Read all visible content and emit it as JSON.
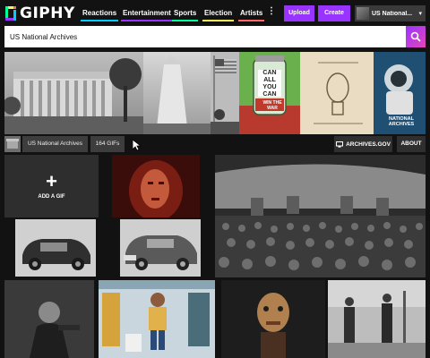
{
  "brand": {
    "name": "GIPHY"
  },
  "nav": {
    "links": [
      {
        "label": "Reactions",
        "accent": "#00ccff"
      },
      {
        "label": "Entertainment",
        "accent": "#9933ff"
      },
      {
        "label": "Sports",
        "accent": "#00ff99"
      },
      {
        "label": "Election",
        "accent": "#fff35c"
      },
      {
        "label": "Artists",
        "accent": "#ff6666"
      }
    ],
    "more_icon": "more-vertical-icon",
    "upload_label": "Upload",
    "create_label": "Create",
    "user_name": "US National...",
    "user_caret": "▾"
  },
  "search": {
    "value": "US National Archives",
    "icon": "search-icon"
  },
  "banner": {
    "poster_line1": "CAN",
    "poster_line2": "ALL YOU",
    "poster_line3": "CAN",
    "poster_footer": "WIN THE WAR",
    "badge_line1": "NATIONAL",
    "badge_line2": "ARCHIVES"
  },
  "channel": {
    "tag1": "US National Archives",
    "tag2": "164 GIFs",
    "archives_label": "ARCHIVES.GOV",
    "about_label": "ABOUT"
  },
  "grid": {
    "add_gif_label": "ADD A GIF",
    "add_gif_icon": "plus-icon"
  },
  "colors": {
    "background": "#121212",
    "accent_purple": "#9933ff",
    "search_gradient_end": "#e646b6"
  }
}
